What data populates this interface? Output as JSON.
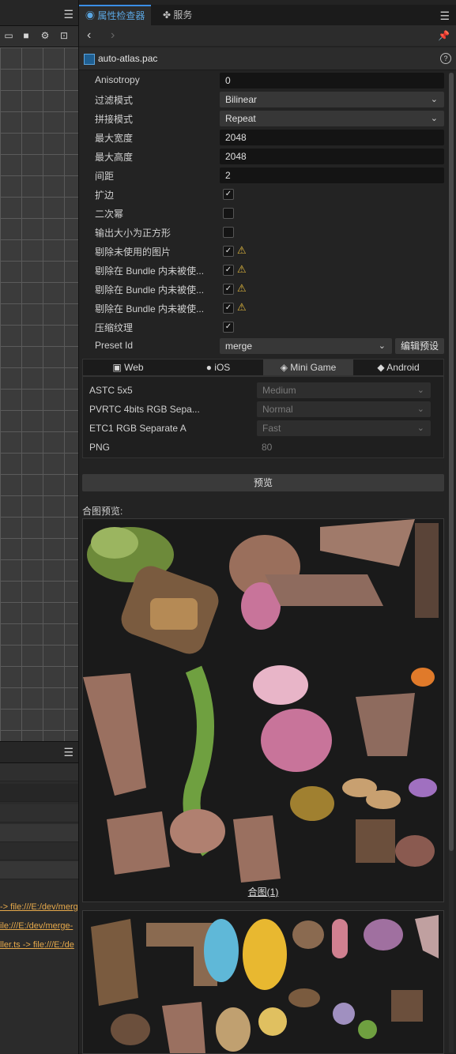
{
  "left_panel": {
    "tools": [
      "frame-icon",
      "camera-icon",
      "gear-icon",
      "fit-icon"
    ],
    "console_links": [
      "-> file:///E:/dev/merg",
      "ile:///E:/dev/merge-",
      "ller.ts -> file:///E:/de"
    ]
  },
  "tabs": {
    "inspector": "属性检查器",
    "services": "服务"
  },
  "file": {
    "name": "auto-atlas.pac"
  },
  "properties": [
    {
      "label": "Anisotropy",
      "kind": "input",
      "value": "0"
    },
    {
      "label": "过滤模式",
      "kind": "select",
      "value": "Bilinear"
    },
    {
      "label": "拼接模式",
      "kind": "select",
      "value": "Repeat"
    },
    {
      "label": "最大宽度",
      "kind": "input",
      "value": "2048"
    },
    {
      "label": "最大高度",
      "kind": "input",
      "value": "2048"
    },
    {
      "label": "间距",
      "kind": "input",
      "value": "2"
    },
    {
      "label": "扩边",
      "kind": "checkbox",
      "checked": true,
      "warn": false
    },
    {
      "label": "二次幂",
      "kind": "checkbox",
      "checked": false,
      "warn": false
    },
    {
      "label": "输出大小为正方形",
      "kind": "checkbox",
      "checked": false,
      "warn": false
    },
    {
      "label": "剔除未使用的图片",
      "kind": "checkbox",
      "checked": true,
      "warn": true
    },
    {
      "label": "剔除在 Bundle 内未被使...",
      "kind": "checkbox",
      "checked": true,
      "warn": true
    },
    {
      "label": "剔除在 Bundle 内未被使...",
      "kind": "checkbox",
      "checked": true,
      "warn": true
    },
    {
      "label": "剔除在 Bundle 内未被使...",
      "kind": "checkbox",
      "checked": true,
      "warn": true
    },
    {
      "label": "压缩纹理",
      "kind": "checkbox",
      "checked": true,
      "warn": false
    }
  ],
  "preset": {
    "label": "Preset Id",
    "value": "merge",
    "edit_button": "编辑预设"
  },
  "platforms": {
    "tabs": [
      {
        "label": "Web",
        "icon": "html5-icon"
      },
      {
        "label": "iOS",
        "icon": "apple-icon"
      },
      {
        "label": "Mini Game",
        "icon": "gamepad-icon"
      },
      {
        "label": "Android",
        "icon": "android-icon"
      }
    ],
    "active": "Mini Game",
    "formats": [
      {
        "label": "ASTC 5x5",
        "kind": "select",
        "value": "Medium"
      },
      {
        "label": "PVRTC 4bits RGB Sepa...",
        "kind": "select",
        "value": "Normal"
      },
      {
        "label": "ETC1 RGB Separate A",
        "kind": "select",
        "value": "Fast"
      },
      {
        "label": "PNG",
        "kind": "text",
        "value": "80"
      }
    ]
  },
  "preview_button": "预览",
  "atlas_preview_label": "合图预览:",
  "atlas_caption": "合图(1)",
  "colors": {
    "accent": "#3a8ee6",
    "warning": "#e3b93e",
    "link": "#e6a94b"
  }
}
